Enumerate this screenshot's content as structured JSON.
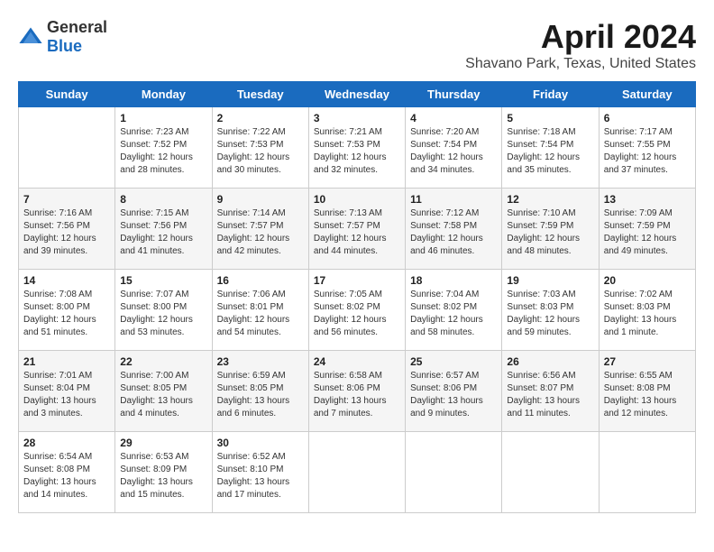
{
  "logo": {
    "general": "General",
    "blue": "Blue"
  },
  "title": "April 2024",
  "subtitle": "Shavano Park, Texas, United States",
  "days_header": [
    "Sunday",
    "Monday",
    "Tuesday",
    "Wednesday",
    "Thursday",
    "Friday",
    "Saturday"
  ],
  "weeks": [
    [
      {
        "day": "",
        "sunrise": "",
        "sunset": "",
        "daylight": ""
      },
      {
        "day": "1",
        "sunrise": "Sunrise: 7:23 AM",
        "sunset": "Sunset: 7:52 PM",
        "daylight": "Daylight: 12 hours and 28 minutes."
      },
      {
        "day": "2",
        "sunrise": "Sunrise: 7:22 AM",
        "sunset": "Sunset: 7:53 PM",
        "daylight": "Daylight: 12 hours and 30 minutes."
      },
      {
        "day": "3",
        "sunrise": "Sunrise: 7:21 AM",
        "sunset": "Sunset: 7:53 PM",
        "daylight": "Daylight: 12 hours and 32 minutes."
      },
      {
        "day": "4",
        "sunrise": "Sunrise: 7:20 AM",
        "sunset": "Sunset: 7:54 PM",
        "daylight": "Daylight: 12 hours and 34 minutes."
      },
      {
        "day": "5",
        "sunrise": "Sunrise: 7:18 AM",
        "sunset": "Sunset: 7:54 PM",
        "daylight": "Daylight: 12 hours and 35 minutes."
      },
      {
        "day": "6",
        "sunrise": "Sunrise: 7:17 AM",
        "sunset": "Sunset: 7:55 PM",
        "daylight": "Daylight: 12 hours and 37 minutes."
      }
    ],
    [
      {
        "day": "7",
        "sunrise": "Sunrise: 7:16 AM",
        "sunset": "Sunset: 7:56 PM",
        "daylight": "Daylight: 12 hours and 39 minutes."
      },
      {
        "day": "8",
        "sunrise": "Sunrise: 7:15 AM",
        "sunset": "Sunset: 7:56 PM",
        "daylight": "Daylight: 12 hours and 41 minutes."
      },
      {
        "day": "9",
        "sunrise": "Sunrise: 7:14 AM",
        "sunset": "Sunset: 7:57 PM",
        "daylight": "Daylight: 12 hours and 42 minutes."
      },
      {
        "day": "10",
        "sunrise": "Sunrise: 7:13 AM",
        "sunset": "Sunset: 7:57 PM",
        "daylight": "Daylight: 12 hours and 44 minutes."
      },
      {
        "day": "11",
        "sunrise": "Sunrise: 7:12 AM",
        "sunset": "Sunset: 7:58 PM",
        "daylight": "Daylight: 12 hours and 46 minutes."
      },
      {
        "day": "12",
        "sunrise": "Sunrise: 7:10 AM",
        "sunset": "Sunset: 7:59 PM",
        "daylight": "Daylight: 12 hours and 48 minutes."
      },
      {
        "day": "13",
        "sunrise": "Sunrise: 7:09 AM",
        "sunset": "Sunset: 7:59 PM",
        "daylight": "Daylight: 12 hours and 49 minutes."
      }
    ],
    [
      {
        "day": "14",
        "sunrise": "Sunrise: 7:08 AM",
        "sunset": "Sunset: 8:00 PM",
        "daylight": "Daylight: 12 hours and 51 minutes."
      },
      {
        "day": "15",
        "sunrise": "Sunrise: 7:07 AM",
        "sunset": "Sunset: 8:00 PM",
        "daylight": "Daylight: 12 hours and 53 minutes."
      },
      {
        "day": "16",
        "sunrise": "Sunrise: 7:06 AM",
        "sunset": "Sunset: 8:01 PM",
        "daylight": "Daylight: 12 hours and 54 minutes."
      },
      {
        "day": "17",
        "sunrise": "Sunrise: 7:05 AM",
        "sunset": "Sunset: 8:02 PM",
        "daylight": "Daylight: 12 hours and 56 minutes."
      },
      {
        "day": "18",
        "sunrise": "Sunrise: 7:04 AM",
        "sunset": "Sunset: 8:02 PM",
        "daylight": "Daylight: 12 hours and 58 minutes."
      },
      {
        "day": "19",
        "sunrise": "Sunrise: 7:03 AM",
        "sunset": "Sunset: 8:03 PM",
        "daylight": "Daylight: 12 hours and 59 minutes."
      },
      {
        "day": "20",
        "sunrise": "Sunrise: 7:02 AM",
        "sunset": "Sunset: 8:03 PM",
        "daylight": "Daylight: 13 hours and 1 minute."
      }
    ],
    [
      {
        "day": "21",
        "sunrise": "Sunrise: 7:01 AM",
        "sunset": "Sunset: 8:04 PM",
        "daylight": "Daylight: 13 hours and 3 minutes."
      },
      {
        "day": "22",
        "sunrise": "Sunrise: 7:00 AM",
        "sunset": "Sunset: 8:05 PM",
        "daylight": "Daylight: 13 hours and 4 minutes."
      },
      {
        "day": "23",
        "sunrise": "Sunrise: 6:59 AM",
        "sunset": "Sunset: 8:05 PM",
        "daylight": "Daylight: 13 hours and 6 minutes."
      },
      {
        "day": "24",
        "sunrise": "Sunrise: 6:58 AM",
        "sunset": "Sunset: 8:06 PM",
        "daylight": "Daylight: 13 hours and 7 minutes."
      },
      {
        "day": "25",
        "sunrise": "Sunrise: 6:57 AM",
        "sunset": "Sunset: 8:06 PM",
        "daylight": "Daylight: 13 hours and 9 minutes."
      },
      {
        "day": "26",
        "sunrise": "Sunrise: 6:56 AM",
        "sunset": "Sunset: 8:07 PM",
        "daylight": "Daylight: 13 hours and 11 minutes."
      },
      {
        "day": "27",
        "sunrise": "Sunrise: 6:55 AM",
        "sunset": "Sunset: 8:08 PM",
        "daylight": "Daylight: 13 hours and 12 minutes."
      }
    ],
    [
      {
        "day": "28",
        "sunrise": "Sunrise: 6:54 AM",
        "sunset": "Sunset: 8:08 PM",
        "daylight": "Daylight: 13 hours and 14 minutes."
      },
      {
        "day": "29",
        "sunrise": "Sunrise: 6:53 AM",
        "sunset": "Sunset: 8:09 PM",
        "daylight": "Daylight: 13 hours and 15 minutes."
      },
      {
        "day": "30",
        "sunrise": "Sunrise: 6:52 AM",
        "sunset": "Sunset: 8:10 PM",
        "daylight": "Daylight: 13 hours and 17 minutes."
      },
      {
        "day": "",
        "sunrise": "",
        "sunset": "",
        "daylight": ""
      },
      {
        "day": "",
        "sunrise": "",
        "sunset": "",
        "daylight": ""
      },
      {
        "day": "",
        "sunrise": "",
        "sunset": "",
        "daylight": ""
      },
      {
        "day": "",
        "sunrise": "",
        "sunset": "",
        "daylight": ""
      }
    ]
  ]
}
